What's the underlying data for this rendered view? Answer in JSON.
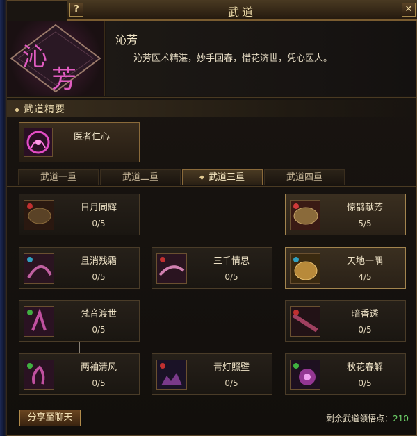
{
  "window": {
    "title": "武道",
    "help_label": "?",
    "close_label": "✕"
  },
  "portrait": {
    "glyph_text": "沁芳"
  },
  "header": {
    "name": "沁芳",
    "description": "沁芳医术精湛，妙手回春，惜花济世，凭心医人。"
  },
  "section": {
    "title": "武道精要"
  },
  "core_skill": {
    "label": "医者仁心",
    "icon": "heart-spiral-icon"
  },
  "tabs": [
    {
      "label": "武道一重"
    },
    {
      "label": "武道二重"
    },
    {
      "label": "武道三重"
    },
    {
      "label": "武道四重"
    }
  ],
  "active_tab": "武道三重",
  "skills": [
    {
      "name": "日月同辉",
      "level": "0/5",
      "icon": "sun-moon-icon",
      "lit": false
    },
    {
      "name": "惊鹊献芳",
      "level": "5/5",
      "icon": "magpie-icon",
      "lit": true
    },
    {
      "name": "且消残霜",
      "level": "0/5",
      "icon": "frost-icon",
      "lit": false
    },
    {
      "name": "三千情思",
      "level": "0/5",
      "icon": "thread-icon",
      "lit": false
    },
    {
      "name": "天地一隅",
      "level": "4/5",
      "icon": "earth-icon",
      "lit": true
    },
    {
      "name": "梵音渡世",
      "level": "0/5",
      "icon": "sound-icon",
      "lit": false
    },
    {
      "name": "暗香透",
      "level": "0/5",
      "icon": "fragrance-icon",
      "lit": false
    },
    {
      "name": "两袖清风",
      "level": "0/5",
      "icon": "wind-icon",
      "lit": false
    },
    {
      "name": "青灯照壁",
      "level": "0/5",
      "icon": "lamp-icon",
      "lit": false
    },
    {
      "name": "秋花春解",
      "level": "0/5",
      "icon": "flower-icon",
      "lit": false
    }
  ],
  "footer": {
    "share_label": "分享至聊天",
    "points_label": "剩余武道领悟点：",
    "points_value": "210"
  },
  "colors": {
    "gold": "#e9d7a6",
    "points_green": "#6ed36a",
    "lit_border": "#a2844e",
    "magenta": "#d040a0"
  }
}
